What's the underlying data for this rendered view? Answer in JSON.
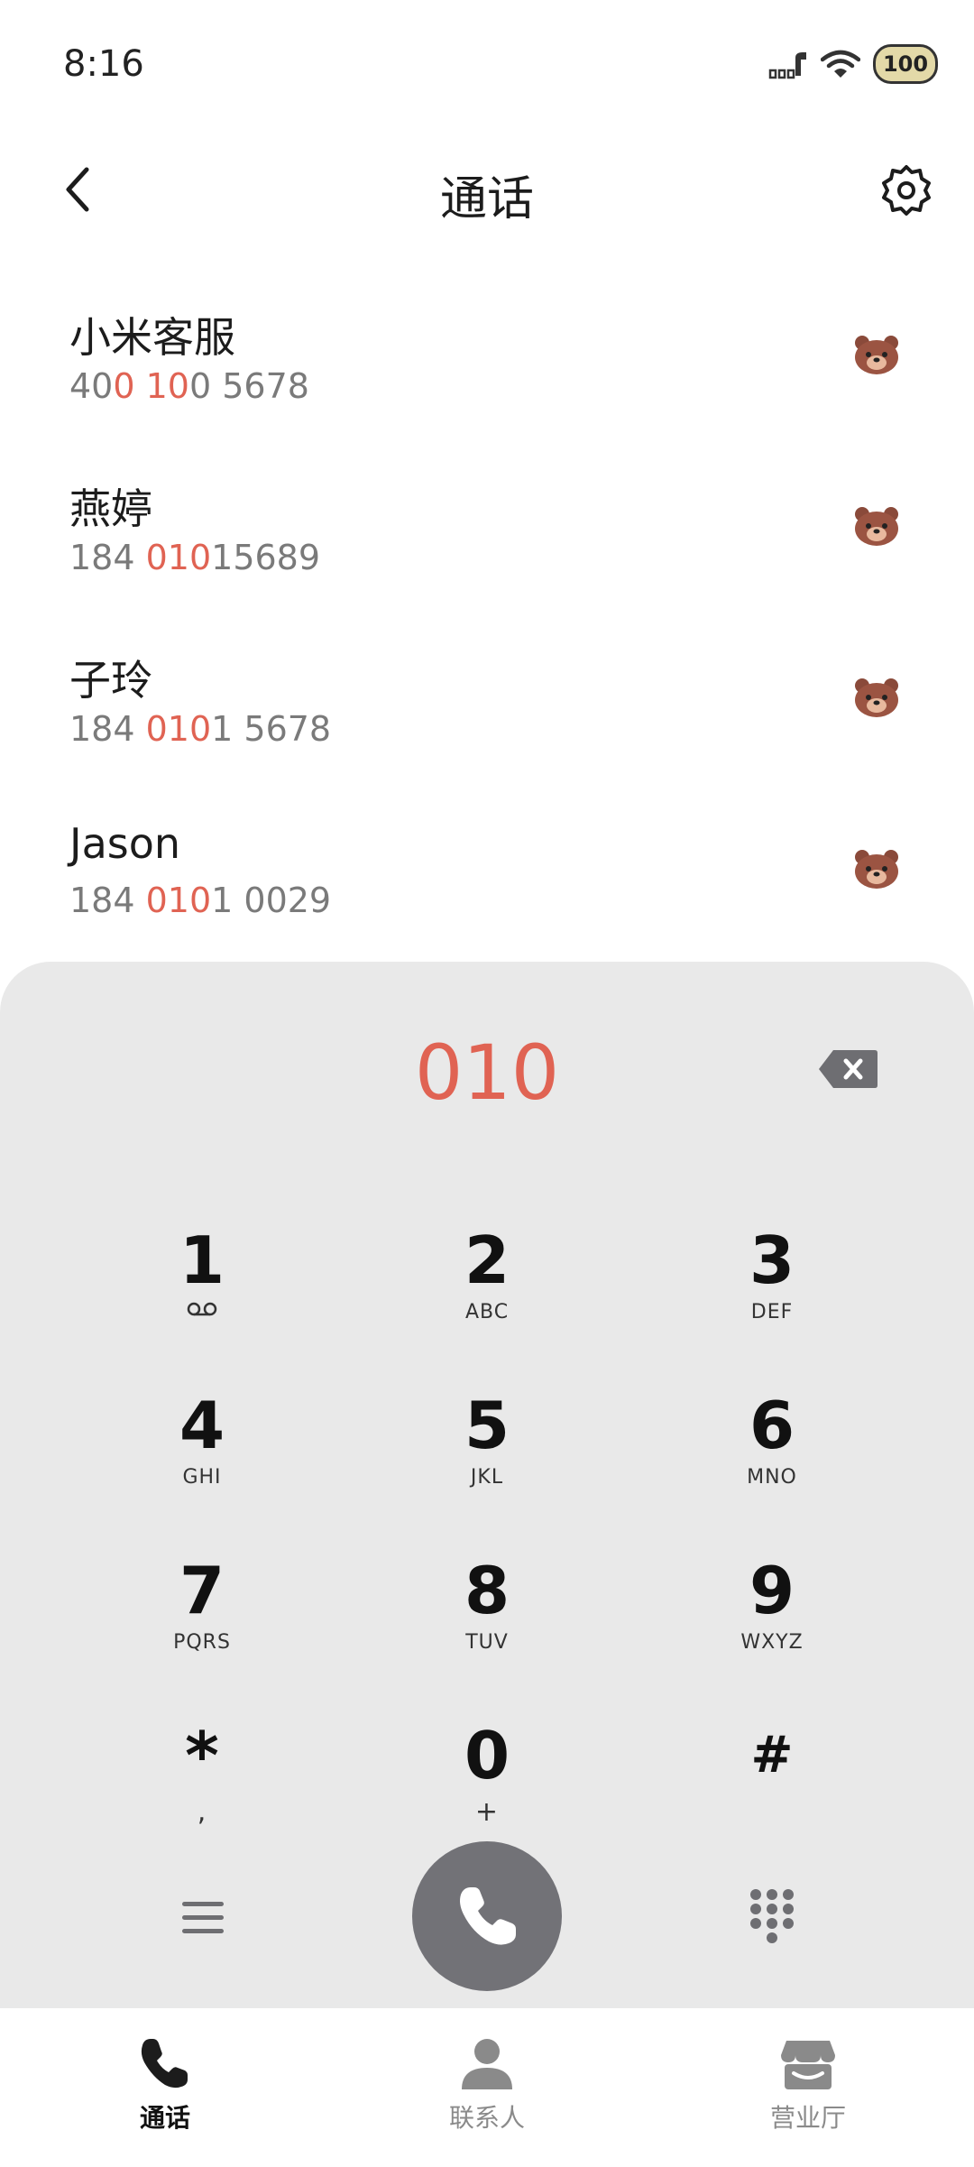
{
  "status_bar": {
    "time": "8:16",
    "battery": "100",
    "icons": [
      "signal-icon",
      "wifi-icon",
      "battery-icon"
    ]
  },
  "header": {
    "title": "通话",
    "back_icon": "chevron-left-icon",
    "settings_icon": "gear-icon"
  },
  "contacts": [
    {
      "name": "小米客服",
      "number_parts": [
        "40",
        "0 10",
        "0 5678"
      ]
    },
    {
      "name": "燕婷",
      "number_parts": [
        "184 ",
        "010",
        "15689"
      ]
    },
    {
      "name": "子玲",
      "number_parts": [
        "184 ",
        "010",
        "1 5678"
      ]
    },
    {
      "name": "Jason",
      "number_parts": [
        "184 ",
        "010",
        "1 0029"
      ]
    }
  ],
  "dialer": {
    "input": "010",
    "keys": [
      {
        "digit": "1",
        "sub": ""
      },
      {
        "digit": "2",
        "sub": "ABC"
      },
      {
        "digit": "3",
        "sub": "DEF"
      },
      {
        "digit": "4",
        "sub": "GHI"
      },
      {
        "digit": "5",
        "sub": "JKL"
      },
      {
        "digit": "6",
        "sub": "MNO"
      },
      {
        "digit": "7",
        "sub": "PQRS"
      },
      {
        "digit": "8",
        "sub": "TUV"
      },
      {
        "digit": "9",
        "sub": "WXYZ"
      },
      {
        "digit": "*",
        "sub": ","
      },
      {
        "digit": "0",
        "sub": "+"
      },
      {
        "digit": "#",
        "sub": ""
      }
    ]
  },
  "tabs": [
    {
      "label": "通话",
      "icon": "phone-icon",
      "active": true
    },
    {
      "label": "联系人",
      "icon": "person-icon",
      "active": false
    },
    {
      "label": "营业厅",
      "icon": "store-icon",
      "active": false
    }
  ],
  "colors": {
    "highlight": "#e06353",
    "panel_bg": "#e9e9e9",
    "call_button": "#727277"
  }
}
